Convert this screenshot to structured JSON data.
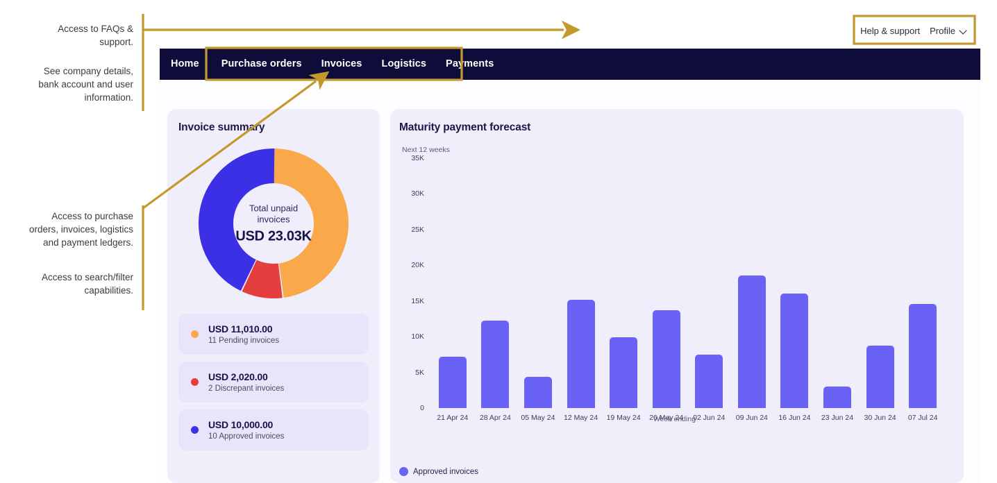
{
  "annotations": {
    "gold": "#c3992e",
    "notes": [
      {
        "id": "annot-1",
        "text": "Access to FAQs &\nsupport."
      },
      {
        "id": "annot-2",
        "text": "See company details,\nbank account and user\ninformation."
      },
      {
        "id": "annot-3",
        "text": "Access to purchase\norders, invoices, logistics\nand payment ledgers."
      },
      {
        "id": "annot-4",
        "text": "Access to search/filter\ncapabilities."
      }
    ]
  },
  "header": {
    "help_label": "Help & support",
    "profile_label": "Profile",
    "chevron_icon": "chevron-down-icon"
  },
  "nav": {
    "items": [
      {
        "label": "Home"
      },
      {
        "label": "Purchase orders"
      },
      {
        "label": "Invoices"
      },
      {
        "label": "Logistics"
      },
      {
        "label": "Payments"
      }
    ]
  },
  "invoice_summary": {
    "title": "Invoice summary",
    "center_label": "Total unpaid\ninvoices",
    "center_value": "USD 23.03K",
    "legend": [
      {
        "color": "#f9a949",
        "amount": "USD 11,010.00",
        "sub": "11 Pending invoices"
      },
      {
        "color": "#e53e3e",
        "amount": "USD 2,020.00",
        "sub": "2 Discrepant invoices"
      },
      {
        "color": "#3b30e6",
        "amount": "USD 10,000.00",
        "sub": "10 Approved invoices"
      }
    ]
  },
  "forecast": {
    "title": "Maturity payment forecast",
    "subtitle": "Next 12 weeks",
    "legend_label": "Approved invoices"
  },
  "chart_data": [
    {
      "type": "pie",
      "title": "Invoice summary",
      "subtype": "donut",
      "center_text": "Total unpaid invoices",
      "center_value": "USD 23.03K",
      "total": 23030,
      "unit": "USD",
      "legend_position": "below",
      "slices": [
        {
          "label": "Pending invoices",
          "value": 11010,
          "count": 11,
          "percent": 47.8,
          "color": "#f9a949"
        },
        {
          "label": "Discrepant invoices",
          "value": 2020,
          "count": 2,
          "percent": 8.8,
          "color": "#e53e3e"
        },
        {
          "label": "Approved invoices",
          "value": 10000,
          "count": 10,
          "percent": 43.4,
          "color": "#3b30e6"
        }
      ]
    },
    {
      "type": "bar",
      "title": "Maturity payment forecast",
      "subtitle": "Next 12 weeks",
      "xlabel": "Week ending",
      "ylabel": "",
      "ylim": [
        0,
        35000
      ],
      "yticks": [
        0,
        5000,
        10000,
        15000,
        20000,
        25000,
        30000,
        35000
      ],
      "ytick_labels": [
        "0",
        "5K",
        "10K",
        "15K",
        "20K",
        "25K",
        "30K",
        "35K"
      ],
      "grid": false,
      "legend_position": "bottom-left",
      "categories": [
        "21 Apr 24",
        "28 Apr 24",
        "05 May 24",
        "12 May 24",
        "19 May 24",
        "26 May 24",
        "02 Jun 24",
        "09 Jun 24",
        "16 Jun 24",
        "23 Jun 24",
        "30 Jun 24",
        "07 Jul 24"
      ],
      "series": [
        {
          "name": "Approved invoices",
          "color": "#6a61f5",
          "values": [
            7200,
            12300,
            4400,
            15200,
            9900,
            13700,
            7500,
            18600,
            16000,
            3000,
            8800,
            14600
          ]
        }
      ]
    }
  ]
}
